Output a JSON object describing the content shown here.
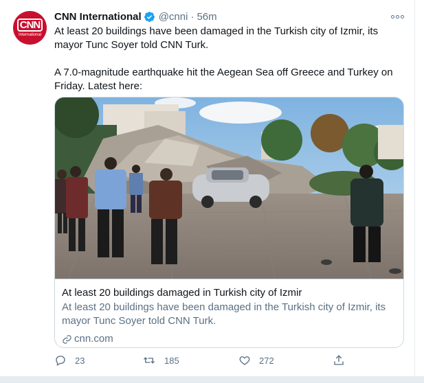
{
  "tweet": {
    "author_name": "CNN International",
    "avatar_logo_text": "CNN",
    "avatar_logo_subtext": "International",
    "handle": "@cnni",
    "separator": "·",
    "time": "56m",
    "paragraphs": [
      "At least 20 buildings have been damaged in the Turkish city of Izmir, its mayor Tunc Soyer told CNN Turk.",
      "A 7.0-magnitude earthquake hit the Aegean Sea off Greece and Turkey on Friday. Latest here:"
    ]
  },
  "card": {
    "title": "At least 20 buildings damaged in Turkish city of Izmir",
    "description": "At least 20 buildings have been damaged in the Turkish city of Izmir, its mayor Tunc Soyer told CNN Turk.",
    "domain": "cnn.com"
  },
  "actions": {
    "reply_count": "23",
    "retweet_count": "185",
    "like_count": "272"
  },
  "colors": {
    "brand_red": "#c8102e",
    "verified_blue": "#1da1f2",
    "muted_text": "#5b7083"
  },
  "icons": [
    "verified-badge-icon",
    "more-options-icon",
    "link-icon",
    "reply-icon",
    "retweet-icon",
    "like-icon",
    "share-icon"
  ]
}
